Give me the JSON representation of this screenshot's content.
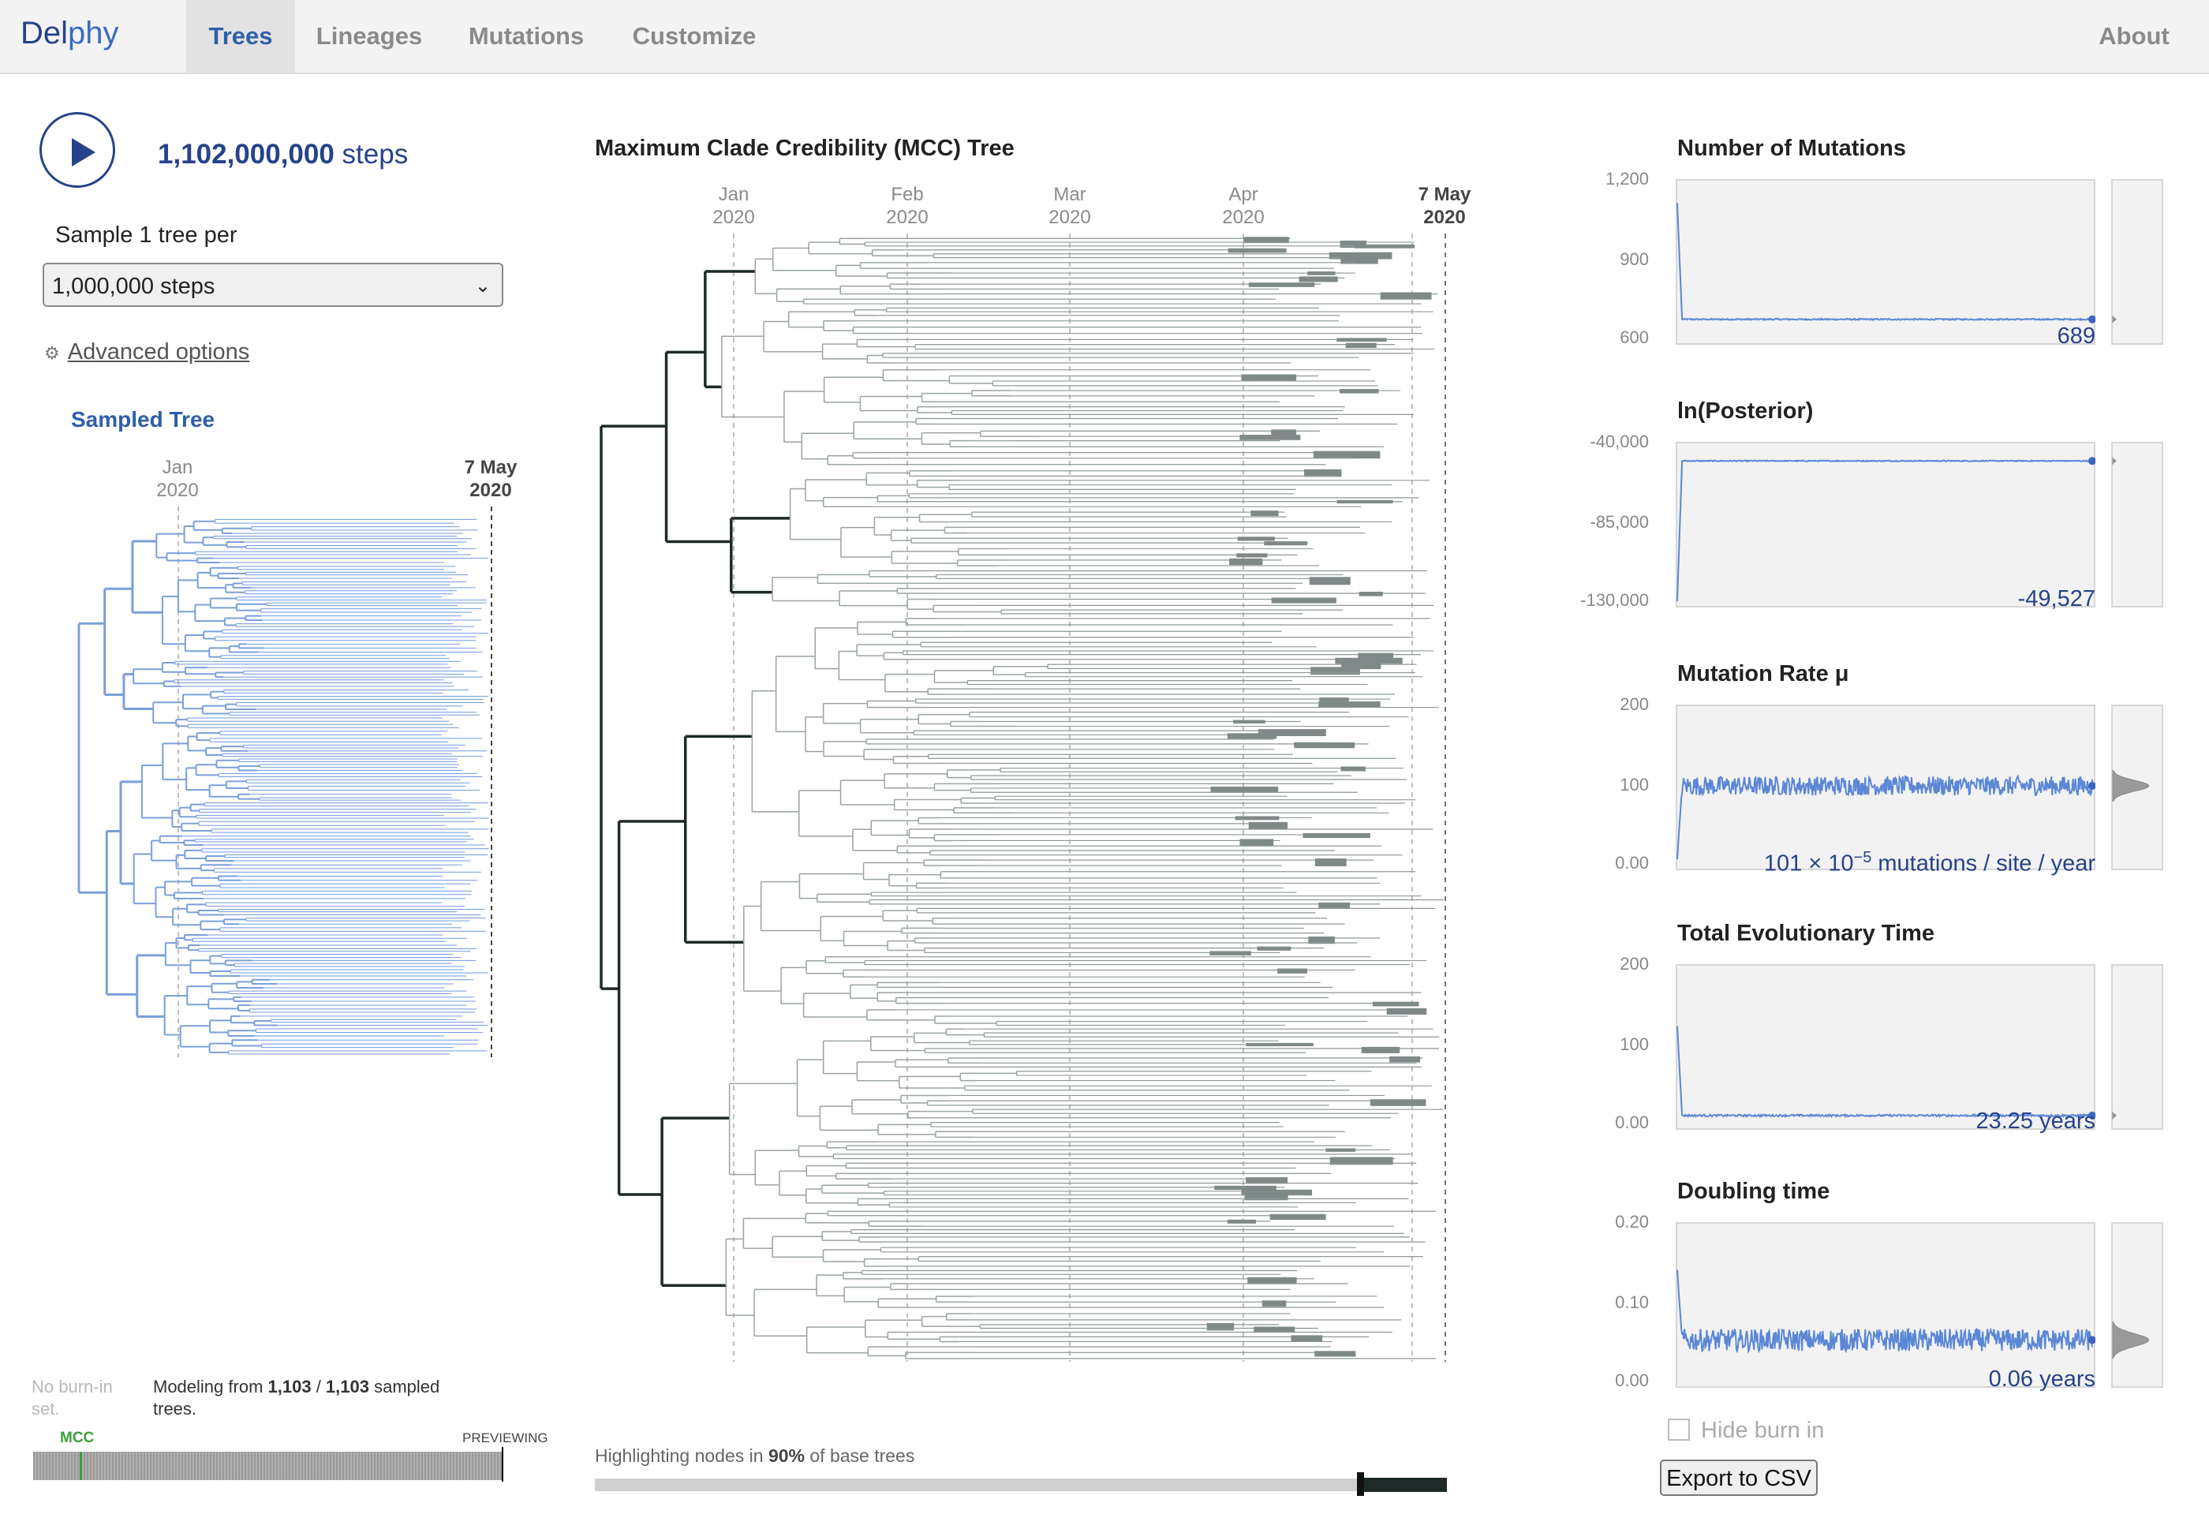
{
  "nav": {
    "logo_a": "Del",
    "logo_b": "phy",
    "tabs": [
      "Trees",
      "Lineages",
      "Mutations",
      "Customize"
    ],
    "active_tab": "Trees",
    "about": "About"
  },
  "left": {
    "steps_number": "1,102,000,000",
    "steps_unit": " steps",
    "sample_label": "Sample 1 tree per",
    "sample_select": "1,000,000 steps",
    "advanced": "Advanced options",
    "sampled_title": "Sampled Tree",
    "axis": [
      {
        "month": "Jan",
        "year": "2020"
      },
      {
        "month": "7 May",
        "year": "2020"
      }
    ],
    "burn_note": "No burn-in set.",
    "modeling_pre": "Modeling from ",
    "modeling_a": "1,103",
    "modeling_sep": " / ",
    "modeling_b": "1,103",
    "modeling_post": " sampled trees.",
    "mcc_label": "MCC",
    "previewing": "PREVIEWING"
  },
  "middle": {
    "title": "Maximum Clade Credibility (MCC) Tree",
    "axis": [
      {
        "month": "Jan",
        "year": "2020"
      },
      {
        "month": "Feb",
        "year": "2020"
      },
      {
        "month": "Mar",
        "year": "2020"
      },
      {
        "month": "Apr",
        "year": "2020"
      },
      {
        "month": "7 May",
        "year": "2020"
      }
    ],
    "highlight_pre": "Highlighting nodes in ",
    "highlight_pct": "90%",
    "highlight_post": " of base trees",
    "highlight_fraction": 0.9
  },
  "right": {
    "accent": "#5b87d6",
    "plots": [
      {
        "title": "Number of Mutations",
        "yticks": [
          "1,200",
          "900",
          "600"
        ],
        "value": "689"
      },
      {
        "title": "ln(Posterior)",
        "yticks": [
          "-40,000",
          "-85,000",
          "-130,000"
        ],
        "value": "-49,527"
      },
      {
        "title": "Mutation Rate μ",
        "yticks": [
          "200",
          "100",
          "0.00"
        ],
        "value": "101 × 10",
        "value_sup": "−5",
        "value_unit": " mutations / site / year"
      },
      {
        "title": "Total Evolutionary Time",
        "yticks": [
          "200",
          "100",
          "0.00"
        ],
        "value": "23.25 years"
      },
      {
        "title": "Doubling time",
        "yticks": [
          "0.20",
          "0.10",
          "0.00"
        ],
        "value": "0.06 years"
      }
    ],
    "hide_burn": "Hide burn in",
    "export": "Export to CSV"
  }
}
